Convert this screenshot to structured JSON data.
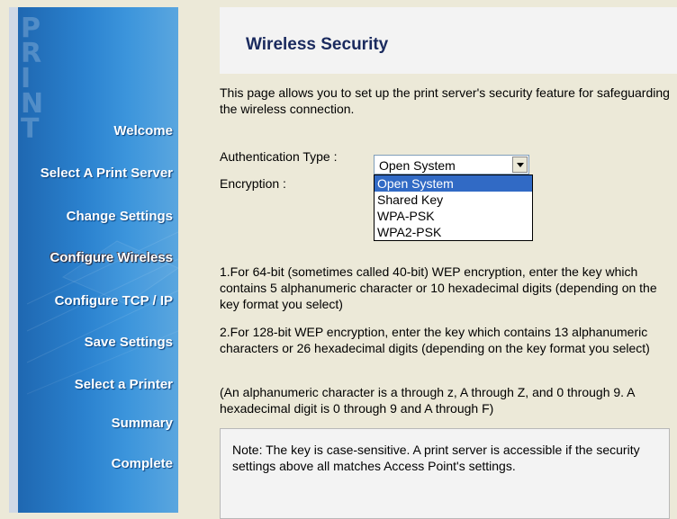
{
  "sidebar": {
    "watermark": "PRINT",
    "items": [
      {
        "label": "Welcome",
        "active": false
      },
      {
        "label": "Select A Print Server",
        "active": false
      },
      {
        "label": "Change Settings",
        "active": false
      },
      {
        "label": "Configure Wireless",
        "active": true
      },
      {
        "label": "Configure TCP / IP",
        "active": false
      },
      {
        "label": "Save Settings",
        "active": false
      },
      {
        "label": "Select a Printer",
        "active": false
      },
      {
        "label": "Summary",
        "active": false
      },
      {
        "label": "Complete",
        "active": false
      }
    ]
  },
  "main": {
    "title": "Wireless Security",
    "intro": "This page allows you to set up the print server's security feature for safeguarding the wireless connection.",
    "auth_label": "Authentication Type :",
    "auth_value": "Open System",
    "encryption_label": "Encryption :",
    "auth_options": [
      "Open System",
      "Shared Key",
      "WPA-PSK",
      "WPA2-PSK"
    ],
    "auth_selected_index": 0,
    "para1": "1.For 64-bit (sometimes called 40-bit) WEP encryption, enter the key which contains 5 alphanumeric character or 10 hexadecimal digits (depending on the key format you select)",
    "para2": "2.For 128-bit WEP encryption, enter the key which contains 13 alphanumeric characters or 26 hexadecimal digits (depending on the key format you select)",
    "para3": "(An alphanumeric character is a through z, A through Z, and 0 through 9. A hexadecimal digit is 0 through 9 and A through F)",
    "note": "Note: The key is case-sensitive. A print server is accessible if the security settings above all matches Access Point's settings."
  },
  "colors": {
    "sidebar_blue": "#2b82cf",
    "title_text": "#1a2a5e",
    "selection": "#316ac5"
  }
}
